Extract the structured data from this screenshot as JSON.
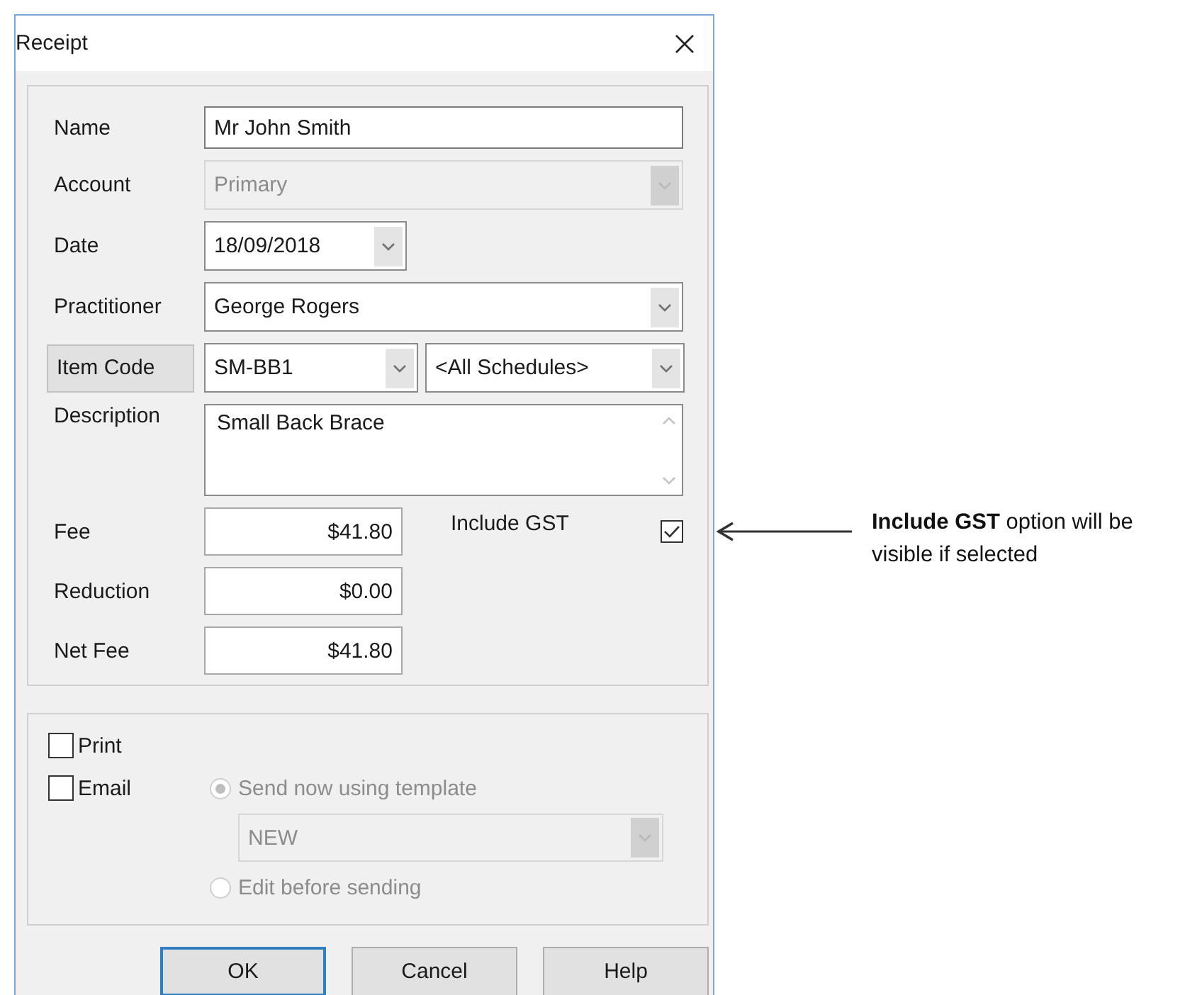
{
  "window": {
    "title": "Receipt"
  },
  "name": {
    "label": "Name",
    "value": "Mr John Smith"
  },
  "account": {
    "label": "Account",
    "value": "Primary",
    "disabled": true
  },
  "date": {
    "label": "Date",
    "value": "18/09/2018"
  },
  "practitioner": {
    "label": "Practitioner",
    "value": "George Rogers"
  },
  "item_code": {
    "button": "Item Code",
    "code": "SM-BB1",
    "schedule": "<All Schedules>"
  },
  "description": {
    "label": "Description",
    "value": "Small Back Brace"
  },
  "amounts": [
    {
      "label": "Fee",
      "value": "$41.80"
    },
    {
      "label": "Reduction",
      "value": "$0.00"
    },
    {
      "label": "Net Fee",
      "value": "$41.80"
    }
  ],
  "include_gst": {
    "label": "Include GST",
    "checked": true
  },
  "print": {
    "label": "Print",
    "checked": false
  },
  "email": {
    "label": "Email",
    "checked": false
  },
  "send_options": [
    {
      "label": "Send now using template",
      "selected": true,
      "disabled": true
    },
    {
      "label": "Edit before sending",
      "selected": false,
      "disabled": true
    }
  ],
  "template": {
    "value": "NEW",
    "disabled": true
  },
  "buttons": [
    {
      "label": "OK",
      "default": true
    },
    {
      "label": "Cancel",
      "default": false
    },
    {
      "label": "Help",
      "default": false
    }
  ],
  "annotation": {
    "text": "**Include GST** option will be visible if selected"
  }
}
